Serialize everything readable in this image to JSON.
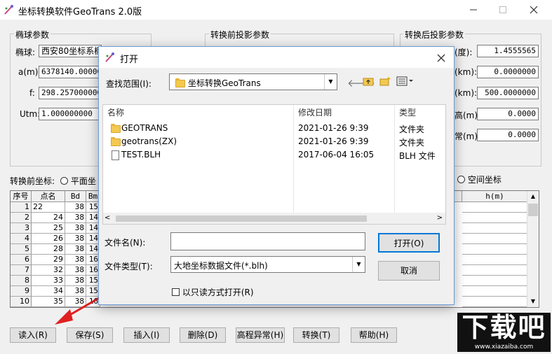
{
  "window": {
    "title": "坐标转换软件GeoTrans 2.0版"
  },
  "ellipsoid": {
    "group_label": "椭球参数",
    "ellipsoid_label": "椭球:",
    "ellipsoid_value": "西安80坐标系椭",
    "a_label": "a(m):",
    "a_value": "6378140.000000",
    "f_label": "f:",
    "f_value": "298.257000000",
    "utm_label": "Utm:",
    "utm_value": "1.000000000"
  },
  "before_proj": {
    "group_label": "转换前投影参数"
  },
  "after_proj": {
    "group_label": "转换后投影参数",
    "rows": [
      {
        "label": "(度):",
        "value": "1.4555565"
      },
      {
        "label": "(km):",
        "value": "0.0000000"
      },
      {
        "label": "(km):",
        "value": "500.0000000"
      },
      {
        "label": "高(m):",
        "value": "0.0000"
      },
      {
        "label": "常(m):",
        "value": "0.0000"
      }
    ]
  },
  "coords": {
    "before_label": "转换前坐标:",
    "plane_option": "平面坐",
    "space_option": "空间坐标"
  },
  "grid": {
    "headers": [
      "序号",
      "点名",
      "Bd",
      "Bm"
    ],
    "right_header": "h(m)",
    "rows": [
      {
        "n": "1",
        "name": "22",
        "bd": "38",
        "bm": "15"
      },
      {
        "n": "2",
        "name": "24",
        "bd": "38",
        "bm": "14"
      },
      {
        "n": "3",
        "name": "25",
        "bd": "38",
        "bm": "14"
      },
      {
        "n": "4",
        "name": "26",
        "bd": "38",
        "bm": "14"
      },
      {
        "n": "5",
        "name": "28",
        "bd": "38",
        "bm": "14"
      },
      {
        "n": "6",
        "name": "29",
        "bd": "38",
        "bm": "16"
      },
      {
        "n": "7",
        "name": "32",
        "bd": "38",
        "bm": "16"
      },
      {
        "n": "8",
        "name": "33",
        "bd": "38",
        "bm": "15"
      },
      {
        "n": "9",
        "name": "34",
        "bd": "38",
        "bm": "15"
      },
      {
        "n": "10",
        "name": "35",
        "bd": "38",
        "bm": "16"
      }
    ]
  },
  "bottom_buttons": {
    "read": "读入(R)",
    "save": "保存(S)",
    "insert": "插入(I)",
    "delete": "删除(D)",
    "elev": "高程异常(H)",
    "convert": "转换(T)",
    "help": "帮助(H)"
  },
  "dialog": {
    "title": "打开",
    "lookin_label": "查找范围(I):",
    "lookin_value": "坐标转换GeoTrans",
    "col_name": "名称",
    "col_date": "修改日期",
    "col_type": "类型",
    "files": [
      {
        "name": "GEOTRANS",
        "date": "2021-01-26 9:39",
        "type": "文件夹",
        "kind": "folder"
      },
      {
        "name": "geotrans(ZX)",
        "date": "2021-01-26 9:39",
        "type": "文件夹",
        "kind": "folder"
      },
      {
        "name": "TEST.BLH",
        "date": "2017-06-04 16:05",
        "type": "BLH 文件",
        "kind": "file"
      }
    ],
    "filename_label": "文件名(N):",
    "filename_value": "",
    "filetype_label": "文件类型(T):",
    "filetype_value": "大地坐标数据文件(*.blh)",
    "readonly_label": "以只读方式打开(R)",
    "open_button": "打开(O)",
    "cancel_button": "取消"
  },
  "watermark": {
    "text": "下载吧",
    "url_text": "www.xiazaiba.com"
  }
}
